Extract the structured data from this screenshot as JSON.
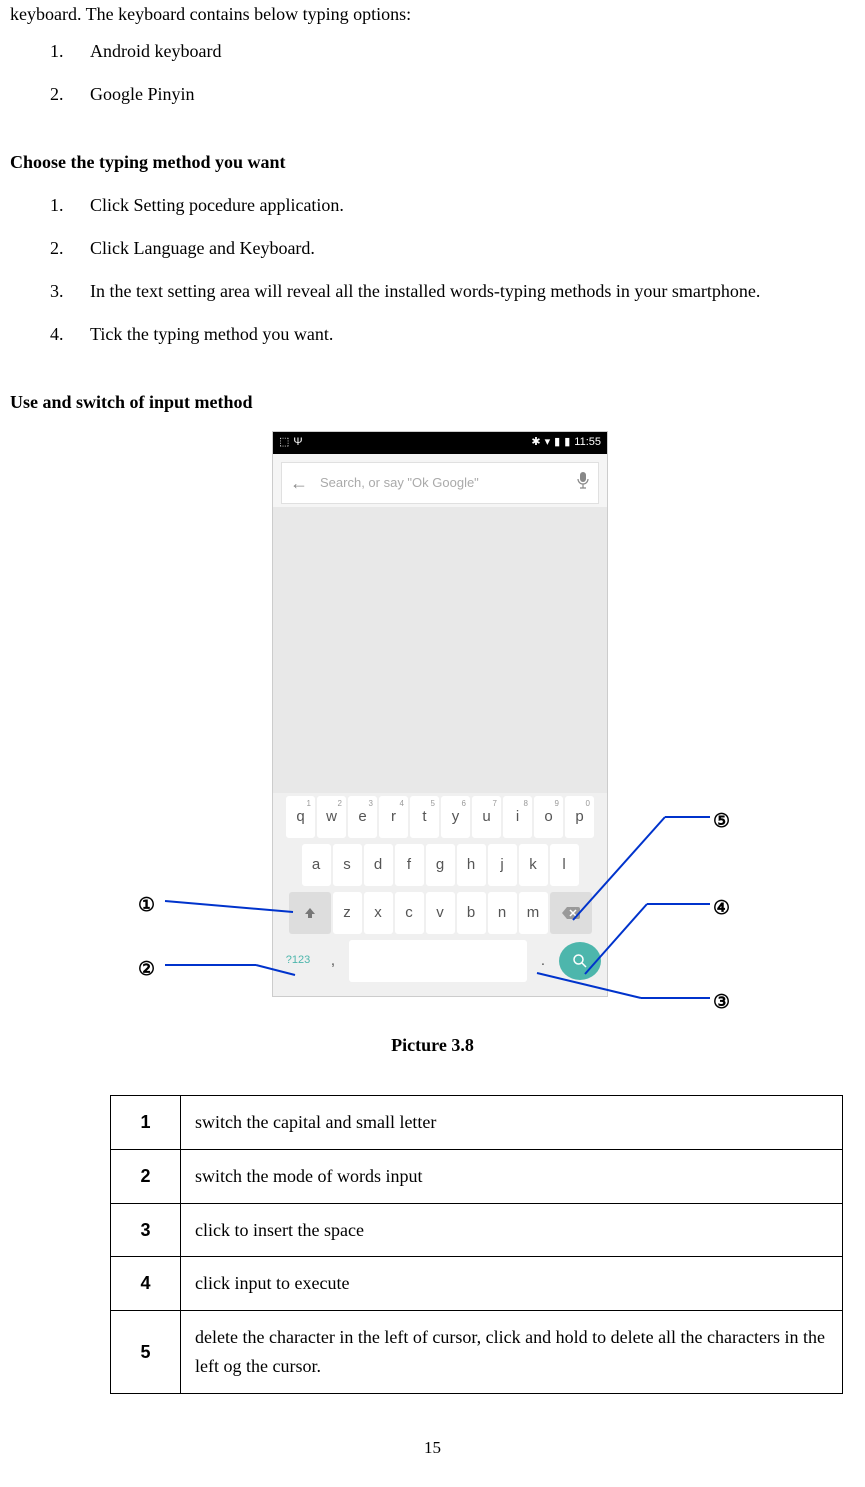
{
  "intro_text": "keyboard. The keyboard contains below typing options:",
  "keyboard_options": [
    {
      "num": "1.",
      "text": "Android keyboard"
    },
    {
      "num": "2.",
      "text": "Google Pinyin"
    }
  ],
  "section1_heading": "Choose the typing method you want",
  "section1_steps": [
    {
      "num": "1.",
      "text": "Click Setting pocedure application."
    },
    {
      "num": "2.",
      "text": "Click Language and Keyboard."
    },
    {
      "num": "3.",
      "text": "In the text setting area will reveal all the installed words-typing methods in your smartphone."
    },
    {
      "num": "4.",
      "text": "Tick the typing method you want."
    }
  ],
  "section2_heading": "Use and switch of input method",
  "screenshot": {
    "status_time": "11:55",
    "search_placeholder": "Search, or say \"Ok Google\"",
    "row1": [
      {
        "k": "q",
        "s": "1"
      },
      {
        "k": "w",
        "s": "2"
      },
      {
        "k": "e",
        "s": "3"
      },
      {
        "k": "r",
        "s": "4"
      },
      {
        "k": "t",
        "s": "5"
      },
      {
        "k": "y",
        "s": "6"
      },
      {
        "k": "u",
        "s": "7"
      },
      {
        "k": "i",
        "s": "8"
      },
      {
        "k": "o",
        "s": "9"
      },
      {
        "k": "p",
        "s": "0"
      }
    ],
    "row2": [
      "a",
      "s",
      "d",
      "f",
      "g",
      "h",
      "j",
      "k",
      "l"
    ],
    "row3": [
      "z",
      "x",
      "c",
      "v",
      "b",
      "n",
      "m"
    ],
    "key_123": "?123",
    "key_comma": ",",
    "key_period": "."
  },
  "callouts": {
    "c1": "①",
    "c2": "②",
    "c3": "③",
    "c4": "④",
    "c5": "⑤"
  },
  "figure_caption": "Picture 3.8",
  "legend_rows": [
    {
      "num": "1",
      "desc": "switch the capital and small letter"
    },
    {
      "num": "2",
      "desc": "switch the mode of words input"
    },
    {
      "num": "3",
      "desc": "click to insert the space"
    },
    {
      "num": "4",
      "desc": "click input to execute"
    },
    {
      "num": "5",
      "desc": "delete the character in the left of cursor, click and hold to delete all the characters in the left og the cursor."
    }
  ],
  "page_number": "15"
}
